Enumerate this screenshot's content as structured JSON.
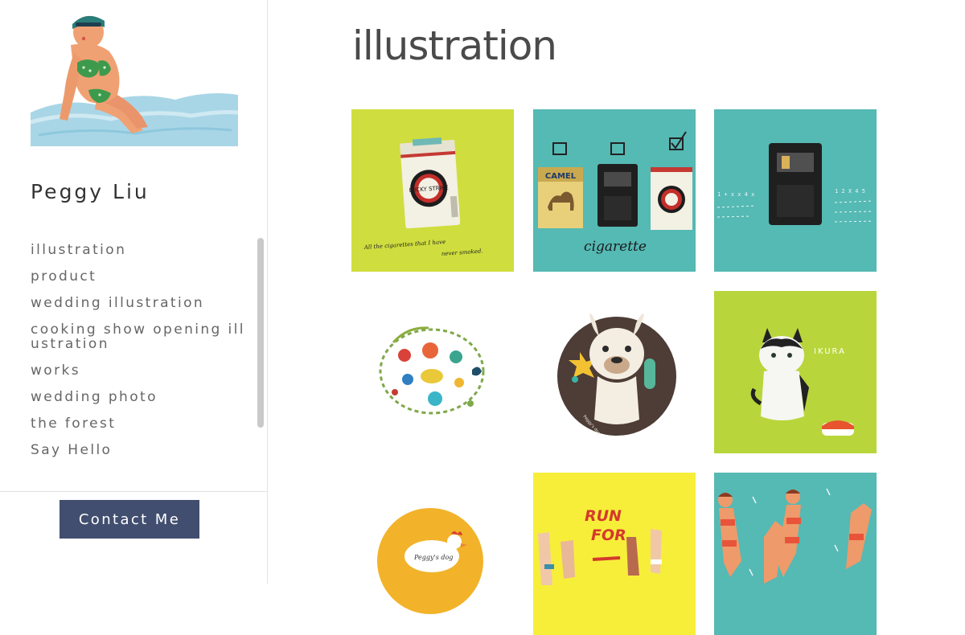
{
  "site": {
    "name": "Peggy Liu"
  },
  "nav": {
    "items": [
      {
        "label": "illustration"
      },
      {
        "label": "product"
      },
      {
        "label": "wedding illustration"
      },
      {
        "label": "cooking show opening illustration"
      },
      {
        "label": "works"
      },
      {
        "label": "wedding photo"
      },
      {
        "label": "the forest"
      },
      {
        "label": "Say Hello"
      }
    ]
  },
  "contact": {
    "label": "Contact Me"
  },
  "page": {
    "title": "illustration"
  },
  "tiles": {
    "t1": {
      "caption_line1": "All the cigarettes that I have",
      "caption_line2": "never smoked.",
      "pack_brand": "LUCKY STRIKE"
    },
    "t2": {
      "caption": "cigarette",
      "camel": "CAMEL",
      "lucky": "LUCKY STRIKE"
    },
    "t3": {
      "left_notes": "1 + x x 4 x",
      "right_notes": "1 2 X 4 5"
    },
    "t5": {
      "tag": "Peggy's dog"
    },
    "t6": {
      "name": "IKURA"
    },
    "t7": {
      "tag": "Peggy's dog"
    },
    "t8": {
      "line1": "RUN",
      "line2": "FOR"
    }
  },
  "colors": {
    "accent_button": "#414e6f",
    "lime": "#cfde3e",
    "teal": "#55b9b4",
    "yellow": "#f7ee3a",
    "green": "#b8d63b"
  }
}
